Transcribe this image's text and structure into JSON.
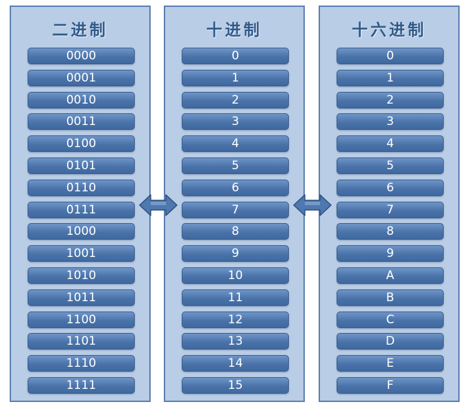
{
  "columns": [
    {
      "title": "二进制",
      "values": [
        "0000",
        "0001",
        "0010",
        "0011",
        "0100",
        "0101",
        "0110",
        "0111",
        "1000",
        "1001",
        "1010",
        "1011",
        "1100",
        "1101",
        "1110",
        "1111"
      ]
    },
    {
      "title": "十进制",
      "values": [
        "0",
        "1",
        "2",
        "3",
        "4",
        "5",
        "6",
        "7",
        "8",
        "9",
        "10",
        "11",
        "12",
        "13",
        "14",
        "15"
      ]
    },
    {
      "title": "十六进制",
      "values": [
        "0",
        "1",
        "2",
        "3",
        "4",
        "5",
        "6",
        "7",
        "8",
        "9",
        "A",
        "B",
        "C",
        "D",
        "E",
        "F"
      ]
    }
  ],
  "icons": [
    "double-arrow-icon",
    "double-arrow-icon"
  ],
  "colors": {
    "panel": "#b9cde6",
    "panel_border": "#5b7fb0",
    "cell": "#4a73a9",
    "title": "#2f5a8a",
    "arrow": "#4f78b0"
  }
}
